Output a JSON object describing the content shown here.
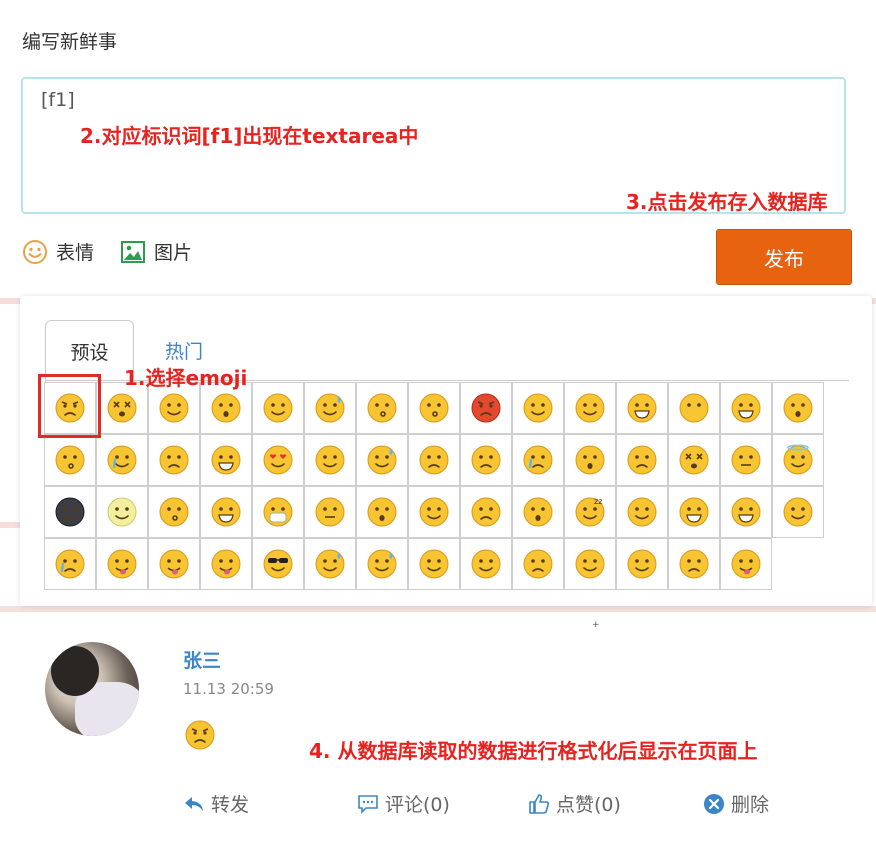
{
  "compose": {
    "title": "编写新鲜事",
    "textarea_value": "[f1]",
    "emoji_label": "表情",
    "image_label": "图片",
    "publish_label": "发布"
  },
  "annotations": {
    "step1": "1.选择emoji",
    "step2": "2.对应标识词[f1]出现在textarea中",
    "step3": "3.点击发布存入数据库",
    "step4": "4. 从数据库读取的数据进行格式化后显示在页面上"
  },
  "emoji_panel": {
    "tabs": [
      {
        "label": "预设",
        "active": true
      },
      {
        "label": "热门",
        "active": false
      }
    ],
    "selected_index": 0,
    "emojis": [
      "angry",
      "dizzy-eyes",
      "smile-blush",
      "surprised-small",
      "confounded",
      "cold-sweat-blue",
      "kissing",
      "kissing-closed-eyes",
      "rage-red",
      "relieved",
      "smiling-blush",
      "grimacing",
      "no-mouth",
      "grinning",
      "flushed",
      "kissing-smiling",
      "joy-tears",
      "frowning",
      "grimace-teeth",
      "heart-eyes",
      "bowtie-man",
      "cold-sweat",
      "confused",
      "disappointed",
      "crying",
      "hushed",
      "disappointed-relieved",
      "dizzy-face",
      "expressionless",
      "innocent-halo",
      "new-moon-face",
      "full-moon-face",
      "kissing-heart",
      "laughing",
      "mask",
      "neutral",
      "open-mouth",
      "persevere",
      "pensive",
      "scream",
      "sleeping",
      "sleepy",
      "smile",
      "smiley",
      "smirk",
      "sob",
      "tongue-out",
      "tongue-squint",
      "tongue-wink",
      "sunglasses",
      "sweat",
      "sweat-smile",
      "tired",
      "triumph",
      "unamused",
      "weary",
      "wink",
      "worried",
      "yum"
    ]
  },
  "post": {
    "username": "张三",
    "time": "11.13 20:59",
    "emoji": "angry",
    "actions": {
      "forward": "转发",
      "comment": "评论(0)",
      "like": "点赞(0)",
      "delete": "删除"
    }
  },
  "colors": {
    "accent_orange": "#e8630f",
    "link_blue": "#3b85c8",
    "annotation_red": "#e6231f",
    "textarea_border": "#b7e4ea"
  }
}
